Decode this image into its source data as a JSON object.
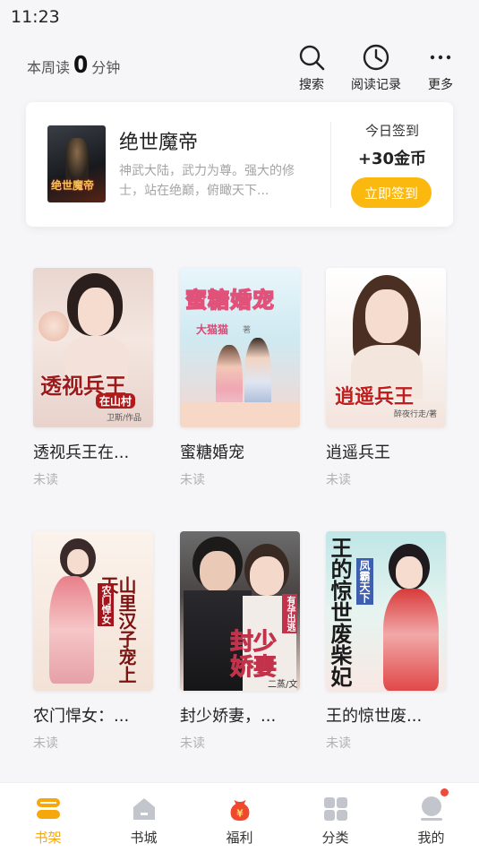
{
  "status_bar": {
    "time": "11:23"
  },
  "header": {
    "weekly_prefix": "本周读",
    "weekly_minutes": "0",
    "weekly_suffix": "分钟",
    "actions": [
      {
        "icon": "search-icon",
        "label": "搜索"
      },
      {
        "icon": "clock-icon",
        "label": "阅读记录"
      },
      {
        "icon": "more-icon",
        "label": "更多"
      }
    ]
  },
  "signin": {
    "book_title": "绝世魔帝",
    "cover_text": "绝世魔帝",
    "description": "神武大陆，武力为尊。强大的修士，站在绝巅，俯瞰天下...",
    "today_label": "今日签到",
    "reward": "+30金币",
    "button_label": "立即签到"
  },
  "books": [
    {
      "title": "透视兵王在...",
      "status": "未读",
      "cover_text": "透视兵王",
      "cover_sub": "在山村",
      "cover_author": "卫斯/作品"
    },
    {
      "title": "蜜糖婚宠",
      "status": "未读",
      "cover_text": "蜜糖婚宠",
      "cover_sub": "大猫猫",
      "cover_author": "著"
    },
    {
      "title": "逍遥兵王",
      "status": "未读",
      "cover_text": "逍遥兵王",
      "cover_sub": "",
      "cover_author": "醉夜行走/著"
    },
    {
      "title": "农门悍女：...",
      "status": "未读",
      "cover_text": "山里汉子宠上天",
      "cover_sub": "农门悍女",
      "cover_author": ""
    },
    {
      "title": "封少娇妻，...",
      "status": "未读",
      "cover_text": "封少娇妻",
      "cover_sub": "有孕出逃",
      "cover_author": "二蒸/文"
    },
    {
      "title": "王的惊世废...",
      "status": "未读",
      "cover_text": "王的惊世废柴妃",
      "cover_sub": "凤霸天下",
      "cover_author": ""
    }
  ],
  "tabs": [
    {
      "icon": "bookshelf-icon",
      "label": "书架",
      "active": true
    },
    {
      "icon": "bookstore-icon",
      "label": "书城",
      "active": false
    },
    {
      "icon": "welfare-icon",
      "label": "福利",
      "active": false
    },
    {
      "icon": "category-icon",
      "label": "分类",
      "active": false
    },
    {
      "icon": "profile-icon",
      "label": "我的",
      "active": false
    }
  ],
  "colors": {
    "accent": "#f5a70b",
    "button": "#fbb80f",
    "badge": "#ee4b3c"
  }
}
